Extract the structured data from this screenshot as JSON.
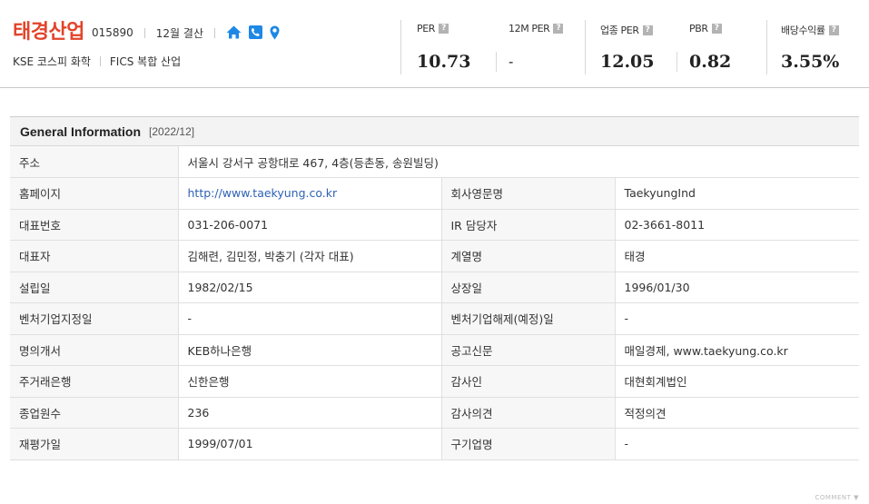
{
  "company": {
    "name": "태경산업",
    "code": "015890",
    "settlement": "12월 결산",
    "icons": [
      "home-icon",
      "phone-icon",
      "location-pin-icon"
    ],
    "market": "KSE  코스피 화학",
    "fics": "FICS 복합 산업"
  },
  "metrics": [
    {
      "label": "PER",
      "value": "10.73"
    },
    {
      "label": "12M PER",
      "value": "-"
    },
    {
      "label": "업종 PER",
      "value": "12.05"
    },
    {
      "label": "PBR",
      "value": "0.82"
    },
    {
      "label": "배당수익률",
      "value": "3.55%"
    }
  ],
  "help_glyph": "?",
  "info": {
    "title": "General Information",
    "period": "[2022/12]",
    "address_label": "주소",
    "address_value": "서울시 강서구 공항대로 467, 4층(등촌동, 송원빌딩)",
    "rows": [
      {
        "l1": "홈페이지",
        "v1": "http://www.taekyung.co.kr",
        "l2": "회사영문명",
        "v2": "TaekyungInd"
      },
      {
        "l1": "대표번호",
        "v1": "031-206-0071",
        "l2": "IR 담당자",
        "v2": "02-3661-8011"
      },
      {
        "l1": "대표자",
        "v1": "김해련, 김민정, 박충기 (각자 대표)",
        "l2": "계열명",
        "v2": "태경"
      },
      {
        "l1": "설립일",
        "v1": "1982/02/15",
        "l2": "상장일",
        "v2": "1996/01/30"
      },
      {
        "l1": "벤처기업지정일",
        "v1": "-",
        "l2": "벤처기업해제(예정)일",
        "v2": "-"
      },
      {
        "l1": "명의개서",
        "v1": "KEB하나은행",
        "l2": "공고신문",
        "v2": "매일경제, www.taekyung.co.kr"
      },
      {
        "l1": "주거래은행",
        "v1": "신한은행",
        "l2": "감사인",
        "v2": "대현회계법인"
      },
      {
        "l1": "종업원수",
        "v1": "236",
        "l2": "감사의견",
        "v2": "적정의견"
      },
      {
        "l1": "재평가일",
        "v1": "1999/07/01",
        "l2": "구기업명",
        "v2": "-"
      }
    ]
  },
  "comment_label": "COMMENT ▼",
  "colors": {
    "brand": "#e2442a",
    "link": "#2e62b4",
    "icon": "#1e88e5"
  }
}
